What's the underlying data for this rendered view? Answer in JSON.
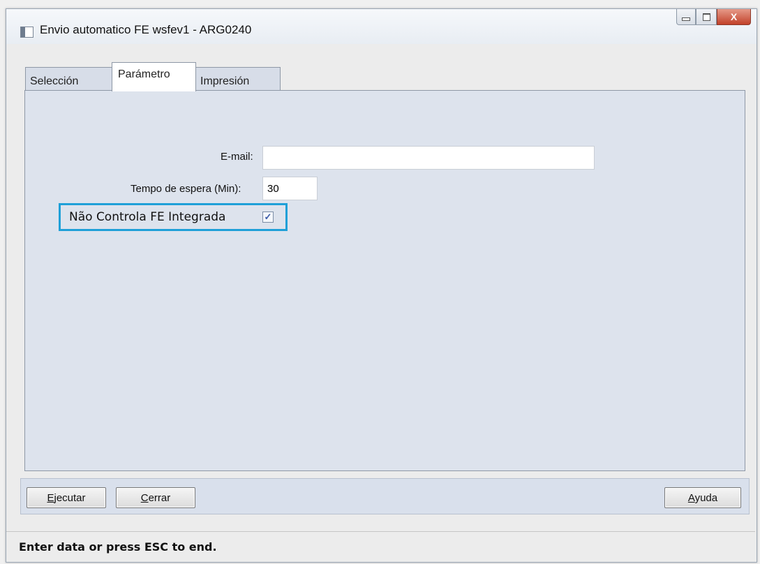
{
  "window": {
    "title": "Envio automatico FE wsfev1 - ARG0240",
    "controls": {
      "minimize_icon": "minimize-icon",
      "maximize_icon": "maximize-icon",
      "close_label": "X"
    }
  },
  "tabs": [
    {
      "label": "Selección",
      "active": false
    },
    {
      "label": "Parámetro",
      "active": true
    },
    {
      "label": "Impresión",
      "active": false
    }
  ],
  "form": {
    "email_label": "E-mail:",
    "email_value": "",
    "wait_label": "Tempo de espera (Min):",
    "wait_value": "30",
    "integrated_label": "Não Controla FE Integrada",
    "integrated_checked": true,
    "check_mark": "✓"
  },
  "buttons": {
    "execute": {
      "mnemonic": "E",
      "rest": "jecutar"
    },
    "close": {
      "mnemonic": "C",
      "rest": "errar"
    },
    "help": {
      "mnemonic": "A",
      "rest": "yuda"
    }
  },
  "status": {
    "text": "Enter data or press ESC to end."
  },
  "colors": {
    "highlight": "#1fa0d8",
    "panel": "#dde3ed",
    "close_button": "#c2412a"
  }
}
